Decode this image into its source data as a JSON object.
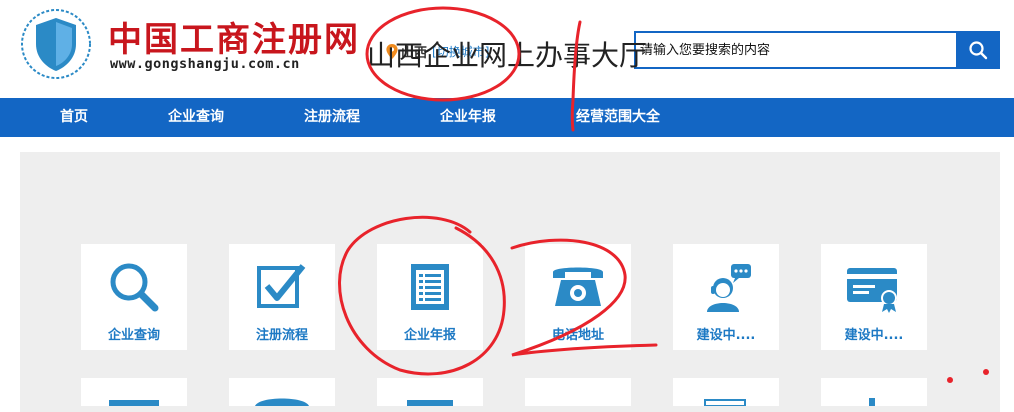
{
  "header": {
    "logo_title": "中国工商注册网",
    "logo_url": "www.gongshangju.com.cn",
    "city_name": "山西",
    "city_switch": "[切换城市]",
    "search_placeholder": "请输入您要搜索的内容"
  },
  "nav": {
    "items": [
      "首页",
      "企业查询",
      "注册流程",
      "企业年报",
      "经营范围大全"
    ]
  },
  "main": {
    "title": "山西企业网上办事大厅",
    "cards": [
      {
        "label": "企业查询",
        "icon": "search-icon"
      },
      {
        "label": "注册流程",
        "icon": "checkbox-icon"
      },
      {
        "label": "企业年报",
        "icon": "document-icon"
      },
      {
        "label": "电话地址",
        "icon": "telephone-icon"
      },
      {
        "label": "建设中....",
        "icon": "customer-service-icon"
      },
      {
        "label": "建设中....",
        "icon": "certificate-icon"
      }
    ],
    "annotations": [
      "1",
      "2"
    ]
  },
  "colors": {
    "brand_red": "#c8161d",
    "brand_blue": "#1366c4",
    "icon_blue": "#2b8ac6",
    "panel_bg": "#eeeeee",
    "annotation_red": "#e8232b"
  }
}
